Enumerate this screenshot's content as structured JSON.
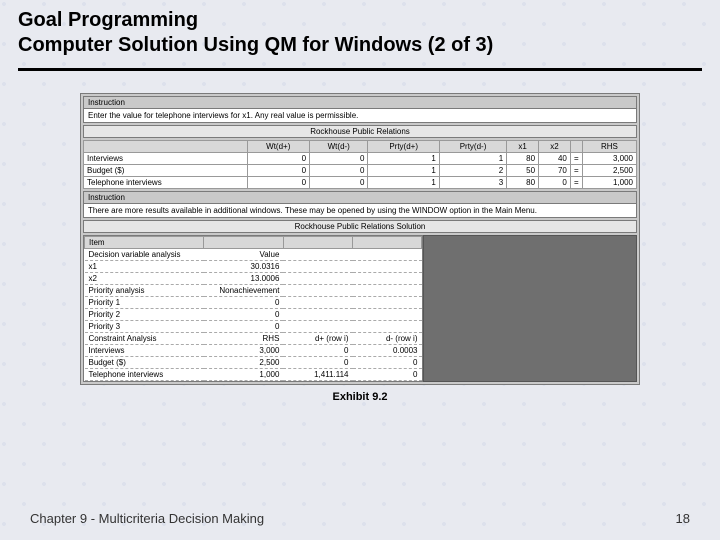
{
  "slide": {
    "title1": "Goal Programming",
    "title2": "Computer Solution Using QM for Windows (2 of 3)",
    "exhibit": "Exhibit 9.2",
    "chapter": "Chapter 9 - Multicriteria Decision Making",
    "page": "18"
  },
  "panel1": {
    "head": "Instruction",
    "body": "Enter the value for telephone interviews for x1. Any real value is permissible.",
    "caption": "Rockhouse Public Relations"
  },
  "grid": {
    "headers": [
      "",
      "Wt(d+)",
      "Wt(d-)",
      "Prty(d+)",
      "Prty(d-)",
      "x1",
      "x2",
      "",
      "RHS"
    ],
    "rows": [
      {
        "label": "Interviews",
        "c": [
          "0",
          "0",
          "1",
          "1",
          "80",
          "40"
        ],
        "sign": "=",
        "rhs": "3,000"
      },
      {
        "label": "Budget ($)",
        "c": [
          "0",
          "0",
          "1",
          "2",
          "50",
          "70"
        ],
        "sign": "=",
        "rhs": "2,500"
      },
      {
        "label": "Telephone interviews",
        "c": [
          "0",
          "0",
          "1",
          "3",
          "80",
          "0"
        ],
        "sign": "=",
        "rhs": "1,000"
      }
    ]
  },
  "panel2": {
    "head": "Instruction",
    "body": "There are more results available in additional windows. These may be opened by using the WINDOW option in the Main Menu.",
    "caption": "Rockhouse Public Relations Solution"
  },
  "results": {
    "item_head": "Item",
    "rows": [
      {
        "label": "Decision variable analysis",
        "v1": "Value",
        "v2": "",
        "v3": ""
      },
      {
        "label": "x1",
        "v1": "30.0316",
        "v2": "",
        "v3": ""
      },
      {
        "label": "x2",
        "v1": "13.0006",
        "v2": "",
        "v3": ""
      },
      {
        "label": "Priority analysis",
        "v1": "Nonachievement",
        "v2": "",
        "v3": ""
      },
      {
        "label": "Priority 1",
        "v1": "0",
        "v2": "",
        "v3": ""
      },
      {
        "label": "Priority 2",
        "v1": "0",
        "v2": "",
        "v3": ""
      },
      {
        "label": "Priority 3",
        "v1": "0",
        "v2": "",
        "v3": ""
      },
      {
        "label": "Constraint Analysis",
        "v1": "RHS",
        "v2": "d+ (row i)",
        "v3": "d- (row i)"
      },
      {
        "label": "Interviews",
        "v1": "3,000",
        "v2": "0",
        "v3": "0.0003"
      },
      {
        "label": "Budget ($)",
        "v1": "2,500",
        "v2": "0",
        "v3": "0"
      },
      {
        "label": "Telephone interviews",
        "v1": "1,000",
        "v2": "1,411.114",
        "v3": "0"
      }
    ]
  }
}
